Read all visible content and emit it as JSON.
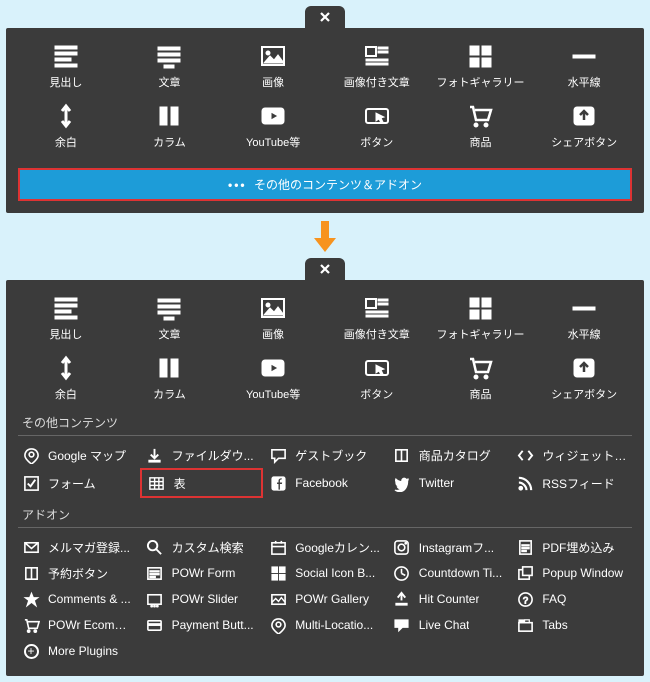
{
  "top_panel": {
    "tiles_row1": [
      {
        "icon": "heading",
        "label": "見出し"
      },
      {
        "icon": "text",
        "label": "文章"
      },
      {
        "icon": "image",
        "label": "画像"
      },
      {
        "icon": "image-text",
        "label": "画像付き文章"
      },
      {
        "icon": "gallery",
        "label": "フォトギャラリー"
      },
      {
        "icon": "hr",
        "label": "水平線"
      }
    ],
    "tiles_row2": [
      {
        "icon": "spacer",
        "label": "余白"
      },
      {
        "icon": "columns",
        "label": "カラム"
      },
      {
        "icon": "youtube",
        "label": "YouTube等"
      },
      {
        "icon": "button",
        "label": "ボタン"
      },
      {
        "icon": "cart",
        "label": "商品"
      },
      {
        "icon": "share",
        "label": "シェアボタン"
      }
    ],
    "more_label": "その他のコンテンツ＆アドオン"
  },
  "bottom_panel": {
    "tiles_row1": [
      {
        "icon": "heading",
        "label": "見出し"
      },
      {
        "icon": "text",
        "label": "文章"
      },
      {
        "icon": "image",
        "label": "画像"
      },
      {
        "icon": "image-text",
        "label": "画像付き文章"
      },
      {
        "icon": "gallery",
        "label": "フォトギャラリー"
      },
      {
        "icon": "hr",
        "label": "水平線"
      }
    ],
    "tiles_row2": [
      {
        "icon": "spacer",
        "label": "余白"
      },
      {
        "icon": "columns",
        "label": "カラム"
      },
      {
        "icon": "youtube",
        "label": "YouTube等"
      },
      {
        "icon": "button",
        "label": "ボタン"
      },
      {
        "icon": "cart",
        "label": "商品"
      },
      {
        "icon": "share",
        "label": "シェアボタン"
      }
    ],
    "other_header": "その他コンテンツ",
    "other_items": [
      {
        "icon": "pin",
        "label": "Google マップ"
      },
      {
        "icon": "download",
        "label": "ファイルダウ..."
      },
      {
        "icon": "chat",
        "label": "ゲストブック"
      },
      {
        "icon": "book",
        "label": "商品カタログ"
      },
      {
        "icon": "code",
        "label": "ウィジェット /..."
      },
      {
        "icon": "check",
        "label": "フォーム"
      },
      {
        "icon": "table",
        "label": "表",
        "highlight": true
      },
      {
        "icon": "facebook",
        "label": "Facebook"
      },
      {
        "icon": "twitter",
        "label": "Twitter"
      },
      {
        "icon": "rss",
        "label": "RSSフィード"
      }
    ],
    "addon_header": "アドオン",
    "addon_items": [
      {
        "icon": "mail",
        "label": "メルマガ登録..."
      },
      {
        "icon": "search",
        "label": "カスタム検索"
      },
      {
        "icon": "calendar",
        "label": "Googleカレン..."
      },
      {
        "icon": "instagram",
        "label": "Instagramフ..."
      },
      {
        "icon": "pdf",
        "label": "PDF埋め込み"
      },
      {
        "icon": "book",
        "label": "予約ボタン"
      },
      {
        "icon": "form",
        "label": "POWr Form"
      },
      {
        "icon": "grid4",
        "label": "Social Icon B..."
      },
      {
        "icon": "clock",
        "label": "Countdown Ti..."
      },
      {
        "icon": "popup",
        "label": "Popup Window"
      },
      {
        "icon": "star",
        "label": "Comments & ..."
      },
      {
        "icon": "slider",
        "label": "POWr Slider"
      },
      {
        "icon": "gallery2",
        "label": "POWr Gallery"
      },
      {
        "icon": "counter",
        "label": "Hit Counter"
      },
      {
        "icon": "faq",
        "label": "FAQ"
      },
      {
        "icon": "cart2",
        "label": "POWr Ecomm..."
      },
      {
        "icon": "card",
        "label": "Payment Butt..."
      },
      {
        "icon": "pin",
        "label": "Multi-Locatio..."
      },
      {
        "icon": "chat2",
        "label": "Live Chat"
      },
      {
        "icon": "tabs",
        "label": "Tabs"
      },
      {
        "icon": "plus",
        "label": "More Plugins"
      }
    ]
  }
}
